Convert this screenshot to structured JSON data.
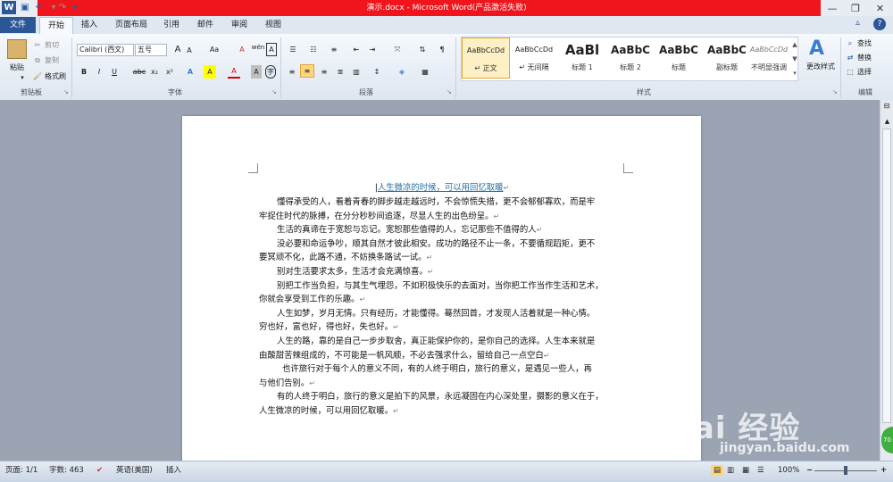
{
  "titlebar": {
    "title": "演示.docx - Microsoft Word(产品激活失败)",
    "accent": "#f0141c"
  },
  "tabs": [
    "文件",
    "开始",
    "插入",
    "页面布局",
    "引用",
    "邮件",
    "审阅",
    "视图"
  ],
  "ribbon": {
    "clipboard": {
      "paste": "粘贴",
      "cut": "剪切",
      "copy": "复制",
      "format_painter": "格式刷",
      "label": "剪贴板"
    },
    "font": {
      "font_name": "Calibri (西文)",
      "font_size": "五号",
      "label": "字体",
      "bold": "B",
      "italic": "I",
      "underline": "U",
      "strike": "abc",
      "sub": "x₂",
      "sup": "x²",
      "grow": "A",
      "shrink": "A",
      "aa": "Aa",
      "clear": "A",
      "highlight": "A",
      "color": "A",
      "char_border": "A",
      "char_shade": "A",
      "wen": "wén",
      "zi": "A"
    },
    "paragraph": {
      "label": "段落"
    },
    "styles": {
      "label": "样式",
      "items": [
        {
          "preview": "AaBbCcDd",
          "name": "↵ 正文"
        },
        {
          "preview": "AaBbCcDd",
          "name": "↵ 无间隔"
        },
        {
          "preview": "AaBl",
          "name": "标题 1"
        },
        {
          "preview": "AaBbC",
          "name": "标题 2"
        },
        {
          "preview": "AaBbC",
          "name": "标题"
        },
        {
          "preview": "AaBbC",
          "name": "副标题"
        },
        {
          "preview": "AaBbCcDd",
          "name": "不明显强调"
        }
      ],
      "change": "更改样式"
    },
    "editing": {
      "find": "查找",
      "replace": "替换",
      "select": "选择",
      "label": "编辑"
    }
  },
  "document": {
    "title": "人生微凉的时候，可以用回忆取暖",
    "paragraphs": [
      {
        "first": "懂得承受的人，看着青春的脚步越走越远时，不会惊慌失措，更不会郁郁寡欢，而是牢",
        "rest": "牢捉住时代的脉搏，在分分秒秒间追逐，尽显人生的出色纷呈。"
      },
      {
        "first": "生活的真谛在于宽恕与忘记。宽恕那些值得的人，忘记那些不值得的人",
        "rest": ""
      },
      {
        "first": "没必要和命运争吵，顺其自然才彼此相安。成功的路径不止一条，不要循规蹈矩，更不",
        "rest": "要冥顽不化，此路不通，不妨换条路试一试。"
      },
      {
        "first": "别对生活要求太多，生活才会充满惊喜。",
        "rest": ""
      },
      {
        "first": "别把工作当负担，与其生气埋怨，不如积极快乐的去面对，当你把工作当作生活和艺术，",
        "rest": "你就会享受到工作的乐趣。"
      },
      {
        "first": "人生如梦，岁月无情。只有经历，才能懂得。蓦然回首，才发现人活着就是一种心情。",
        "rest": "穷也好，富也好，得也好，失也好。"
      },
      {
        "first": "人生的路，靠的是自己一步步取舍，真正能保护你的，是你自己的选择。人生本来就是",
        "rest": "由酸甜苦辣组成的，不可能是一帆风顺，不必去强求什么，留给自己一点空白"
      },
      {
        "first": "也许旅行对于每个人的意义不同，有的人终于明白，旅行的意义，是遇见一些人，再",
        "rest": "与他们告别。"
      },
      {
        "first": "有的人终于明白，旅行的意义是拍下的风景，永远凝固在内心深处里，摄影的意义在于，",
        "rest": "人生微凉的时候，可以用回忆取暖。"
      }
    ],
    "para_mark": "↵"
  },
  "statusbar": {
    "page": "页面: 1/1",
    "words": "字数: 463",
    "lang": "英语(美国)",
    "mode": "插入",
    "zoom": "100%",
    "minus": "−",
    "plus": "+"
  },
  "watermark": {
    "logo": "Bai 经验",
    "url": "jingyan.baidu.com"
  },
  "badge": "70"
}
